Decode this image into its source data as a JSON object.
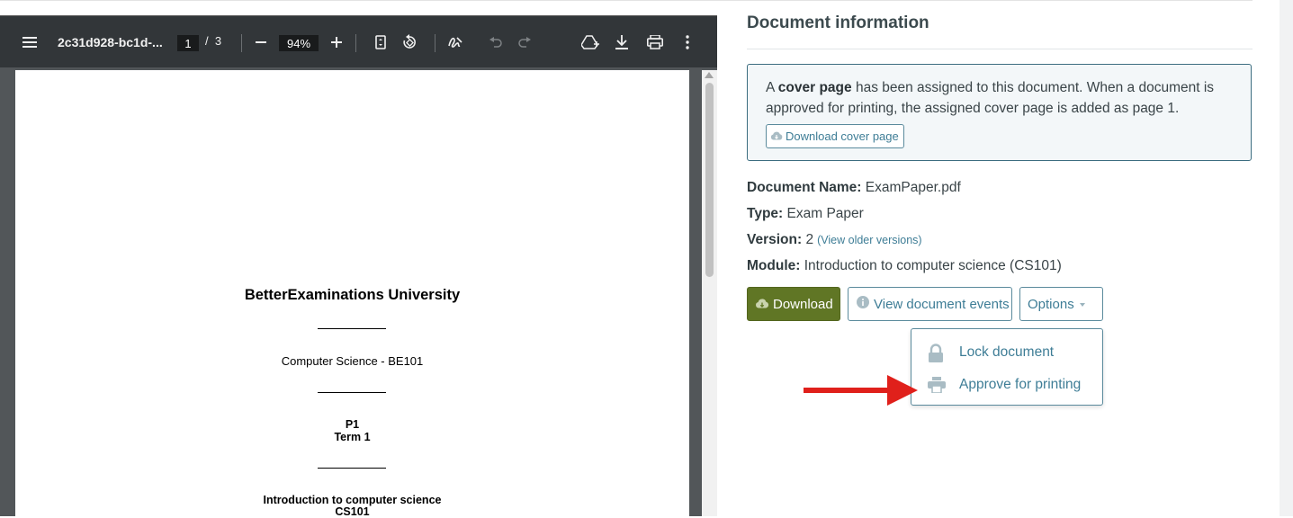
{
  "pdf_viewer": {
    "file_title": "2c31d928-bc1d-...",
    "current_page": "1",
    "page_separator": "/",
    "total_pages": "3",
    "zoom": "94%",
    "toolbar_icons": [
      "menu-icon",
      "zoom-out-icon",
      "zoom-in-icon",
      "fit-page-icon",
      "rotate-icon",
      "annotate-icon",
      "undo-icon",
      "redo-icon",
      "add-to-drive-icon",
      "download-icon",
      "print-icon",
      "more-options-icon"
    ],
    "page_content": {
      "university": "BetterExaminations University",
      "course": "Computer Science - BE101",
      "paper_line1": "P1",
      "paper_line2": "Term 1",
      "module_line1": "Introduction to computer science",
      "module_line2": "CS101"
    }
  },
  "panel": {
    "title": "Document information",
    "alert": {
      "prefix": "A ",
      "bold": "cover page",
      "suffix": " has been assigned to this document. When a document is approved for printing, the assigned cover page is added as page 1.",
      "button_label": "Download cover page"
    },
    "fields": {
      "name_label": "Document Name:",
      "name_value": "ExamPaper.pdf",
      "type_label": "Type:",
      "type_value": "Exam Paper",
      "version_label": "Version:",
      "version_value": "2",
      "version_link": "(View older versions)",
      "module_label": "Module:",
      "module_value": "Introduction to computer science (CS101)"
    },
    "buttons": {
      "download": "Download",
      "view_events": "View document events",
      "options": "Options"
    },
    "options_menu": [
      {
        "label": "Lock document",
        "icon": "lock-icon"
      },
      {
        "label": "Approve for printing",
        "icon": "printer-icon"
      }
    ]
  },
  "colors": {
    "toolbar_bg": "#323639",
    "download_button": "#607625",
    "link": "#3e7d96",
    "annotation_arrow": "#e0201b"
  }
}
